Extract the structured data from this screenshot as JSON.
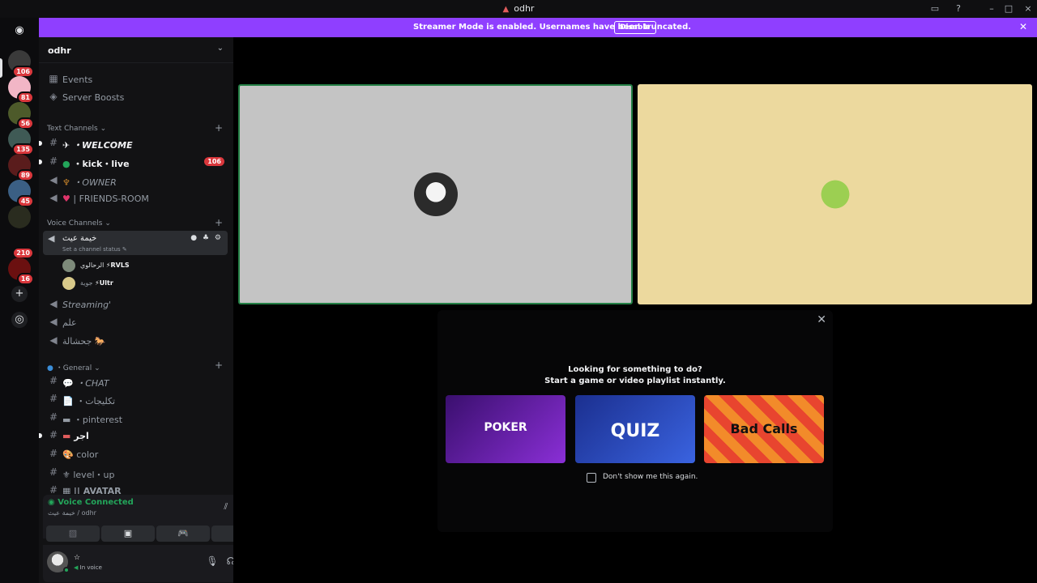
{
  "window": {
    "title": "odhr"
  },
  "banner": {
    "text": "Streamer Mode is enabled. Usernames have been truncated.",
    "button": "Disable"
  },
  "rail": {
    "badges": [
      "106",
      "81",
      "56",
      "135",
      "89",
      "45",
      "210",
      "16"
    ]
  },
  "guild": {
    "name": "odhr"
  },
  "top_items": [
    {
      "label": "Events"
    },
    {
      "label": "Server Boosts"
    }
  ],
  "categories": {
    "text": "Text Channels",
    "voice": "Voice Channels",
    "general": "・General"
  },
  "text_channels": [
    {
      "label": "・WELCOME"
    },
    {
      "label": "・kick・live",
      "badge": "106"
    },
    {
      "label": "・OWNER"
    },
    {
      "label": "| FRIENDS-ROOM"
    }
  ],
  "voice_channel": {
    "label": "خيمة عيث",
    "status": "Set a channel status"
  },
  "voice_members": [
    {
      "name": "الرحالوي",
      "tag": "⚡RVLS"
    },
    {
      "name": "جوية",
      "tag": "⚡Ultr"
    }
  ],
  "voice_channels_more": [
    {
      "label": "Streaming'"
    },
    {
      "label": "علم"
    },
    {
      "label": "جحشالة"
    }
  ],
  "general_channels": [
    {
      "label": "・CHAT"
    },
    {
      "label": "・تكليجات"
    },
    {
      "label": "・pinterest"
    },
    {
      "label": "اجر"
    },
    {
      "label": "color"
    },
    {
      "label": "level・up"
    },
    {
      "label": "|| AVATAR"
    }
  ],
  "voice_panel": {
    "connected": "Voice Connected",
    "location": "خيمة عيث / odhr"
  },
  "user": {
    "name": "☆",
    "status": "In voice"
  },
  "activity": {
    "line1": "Looking for something to do?",
    "line2": "Start a game or video playlist instantly.",
    "cards": [
      {
        "label": "POKER",
        "color": "#6a1fb0"
      },
      {
        "label": "QUIZ",
        "color": "#2447c9"
      },
      {
        "label": "Bad Calls",
        "color": "#e8452f"
      }
    ],
    "checkbox": "Don't show me this again."
  },
  "colors": {
    "accent": "#8f3fff",
    "green": "#23a55a",
    "red": "#da373c"
  }
}
